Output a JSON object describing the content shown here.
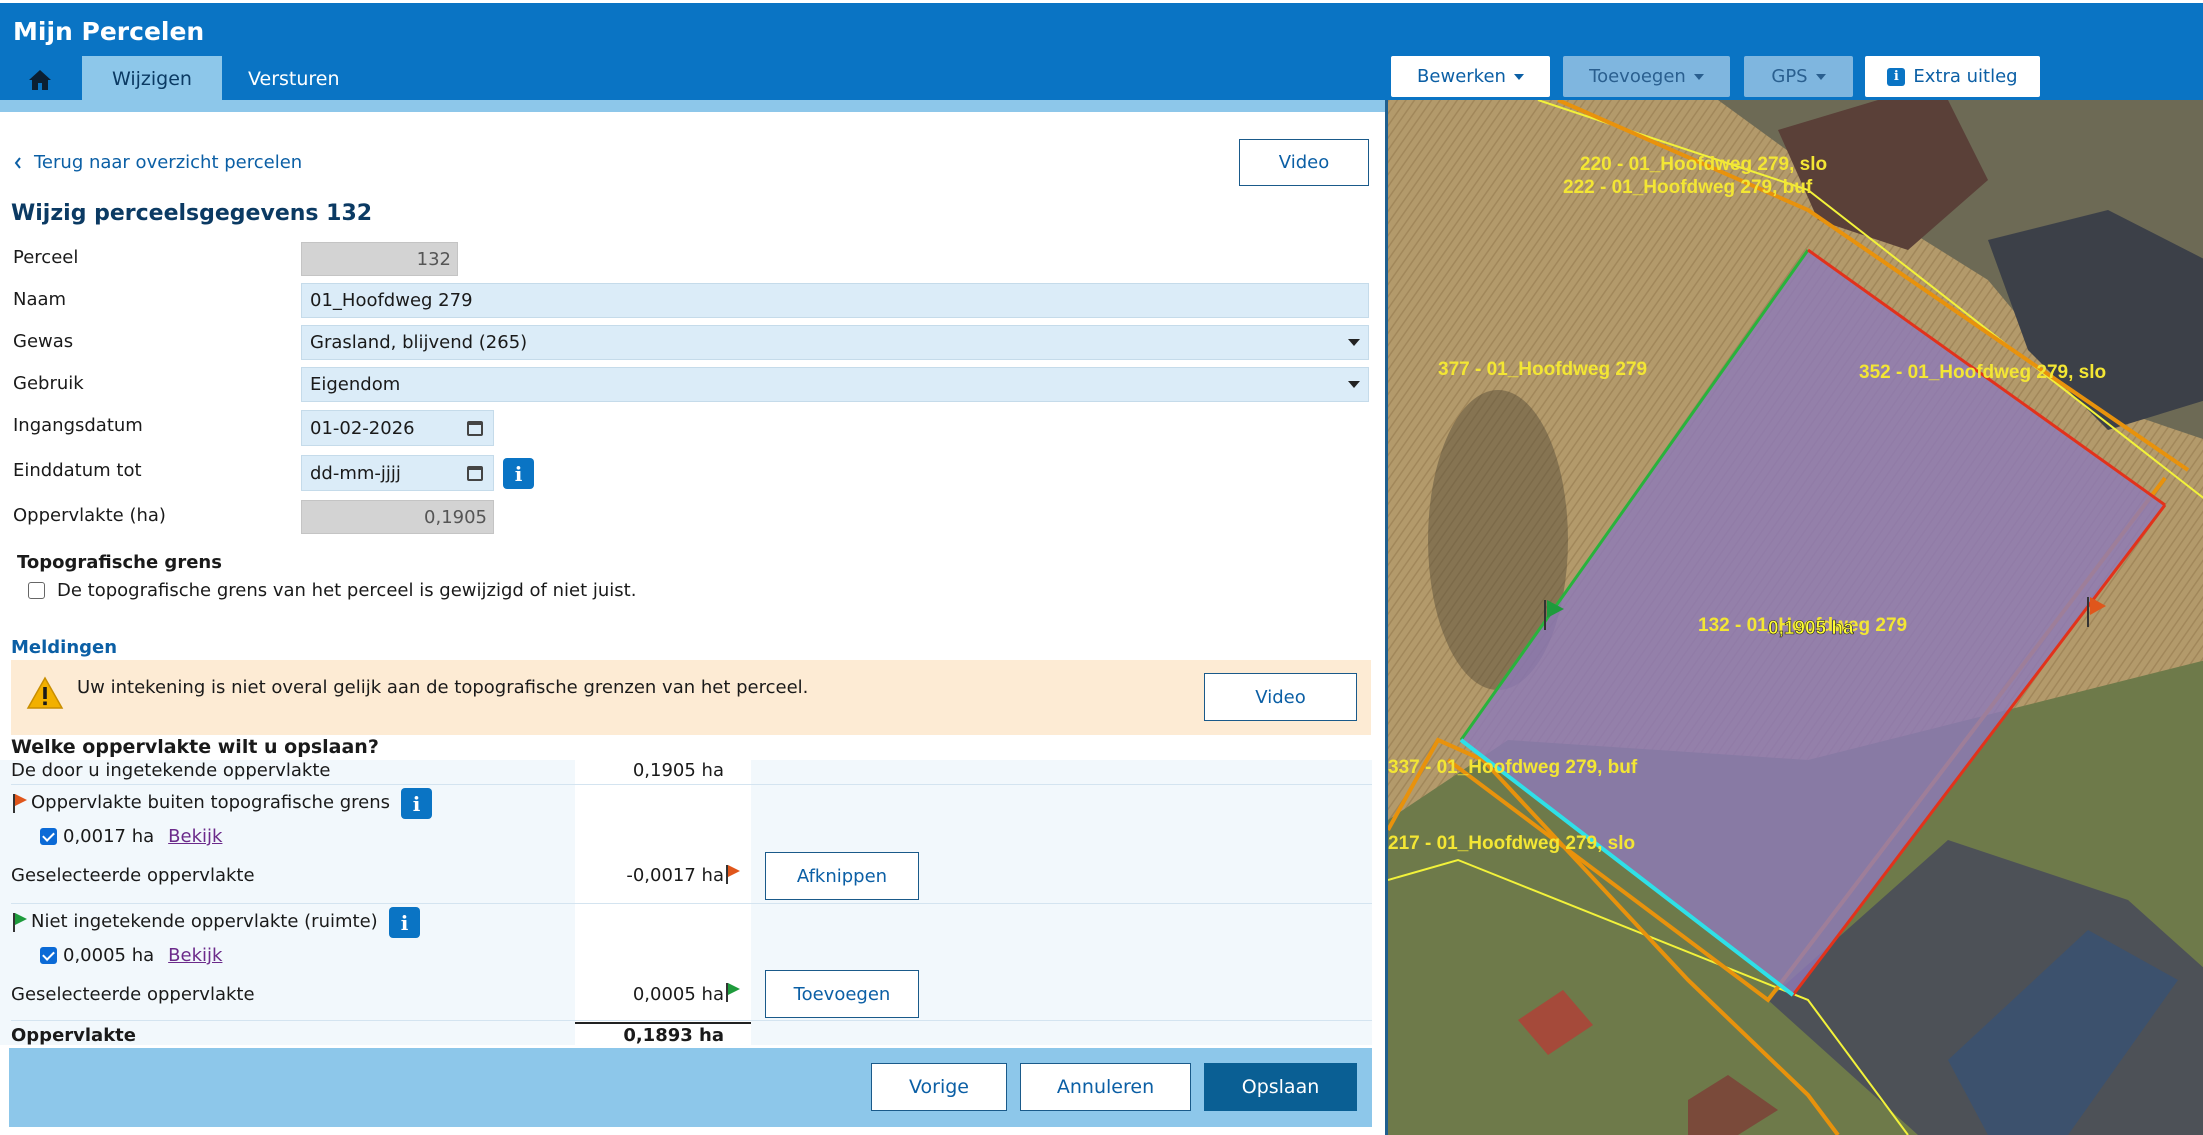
{
  "app": {
    "title": "Mijn Percelen"
  },
  "nav": {
    "home_icon": "home-icon",
    "tabs": [
      {
        "label": "Wijzigen",
        "active": true
      },
      {
        "label": "Versturen",
        "active": false
      }
    ]
  },
  "map_toolbar": {
    "bewerken": "Bewerken",
    "toevoegen": "Toevoegen",
    "gps": "GPS",
    "extra_uitleg": "Extra uitleg"
  },
  "back_link": "Terug naar overzicht percelen",
  "video_label": "Video",
  "form": {
    "title": "Wijzig perceelsgegevens 132",
    "fields": {
      "perceel": {
        "label": "Perceel",
        "value": "132"
      },
      "naam": {
        "label": "Naam",
        "value": "01_Hoofdweg 279"
      },
      "gewas": {
        "label": "Gewas",
        "value": "Grasland, blijvend (265)"
      },
      "gebruik": {
        "label": "Gebruik",
        "value": "Eigendom"
      },
      "ingangsdatum": {
        "label": "Ingangsdatum",
        "value": "01-02-2026"
      },
      "einddatum": {
        "label": "Einddatum tot",
        "placeholder": "dd-mm-jjjj"
      },
      "oppervlakte": {
        "label": "Oppervlakte (ha)",
        "value": "0,1905"
      }
    }
  },
  "topo": {
    "heading": "Topografische grens",
    "checkbox_label": "De topografische grens van het perceel is gewijzigd of niet juist.",
    "checked": false
  },
  "meldingen": {
    "heading": "Meldingen",
    "warning": "Uw intekening is niet overal gelijk aan de topografische grenzen van het perceel.",
    "video_label": "Video"
  },
  "calc": {
    "question": "Welke oppervlakte wilt u opslaan?",
    "drawn_label": "De door u ingetekende oppervlakte",
    "drawn_value": "0,1905 ha",
    "outside": {
      "label": "Oppervlakte buiten topografische grens",
      "item_value": "0,0017 ha",
      "item_checked": true,
      "bekijk": "Bekijk",
      "selected_label": "Geselecteerde oppervlakte",
      "selected_value": "-0,0017 ha",
      "action": "Afknippen",
      "flag_color": "#e0561b"
    },
    "missing": {
      "label": "Niet ingetekende oppervlakte (ruimte)",
      "item_value": "0,0005 ha",
      "item_checked": true,
      "bekijk": "Bekijk",
      "selected_label": "Geselecteerde oppervlakte",
      "selected_value": "0,0005 ha",
      "action": "Toevoegen",
      "flag_color": "#1e9b3c"
    },
    "total_label": "Oppervlakte",
    "total_value": "0,1893 ha"
  },
  "footer": {
    "vorige": "Vorige",
    "annuleren": "Annuleren",
    "opslaan": "Opslaan"
  },
  "map": {
    "labels": [
      "220  - 01_Hoofdweg 279, slo",
      "222  - 01_Hoofdweg 279, buf",
      "377  - 01_Hoofdweg 279",
      "352  - 01_Hoofdweg 279, slo",
      "132  - 01_Hoofdweg 279",
      "0,1905 ha",
      "337  - 01_Hoofdweg 279, buf",
      "217  - 01_Hoofdweg 279, slo"
    ],
    "colors": {
      "parcel_fill": "#8e7ab8",
      "outline_orange": "#e8920c",
      "outline_red": "#e2321b",
      "outline_green": "#29b33c",
      "outline_cyan": "#2fe0e8",
      "outline_yellow": "#f2f23a",
      "label_yellow": "#f3e634"
    }
  }
}
